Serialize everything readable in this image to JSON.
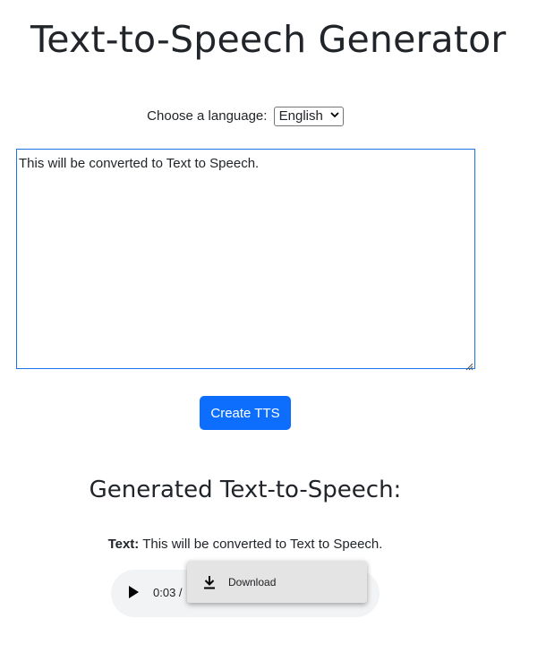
{
  "page": {
    "title": "Text-to-Speech Generator"
  },
  "language": {
    "label": "Choose a language:",
    "selected": "English",
    "dropdown_icon": "chevron-down-icon"
  },
  "input": {
    "value": "This will be converted to Text to Speech."
  },
  "actions": {
    "create_label": "Create TTS",
    "create_color": "#0d6efd"
  },
  "result": {
    "heading": "Generated Text-to-Speech:",
    "text_label": "Text:",
    "text_value": "This will be converted to Text to Speech."
  },
  "audio": {
    "play_icon": "play-icon",
    "current_time": "0:03 /"
  },
  "context_menu": {
    "icon": "download-icon",
    "download_label": "Download"
  }
}
